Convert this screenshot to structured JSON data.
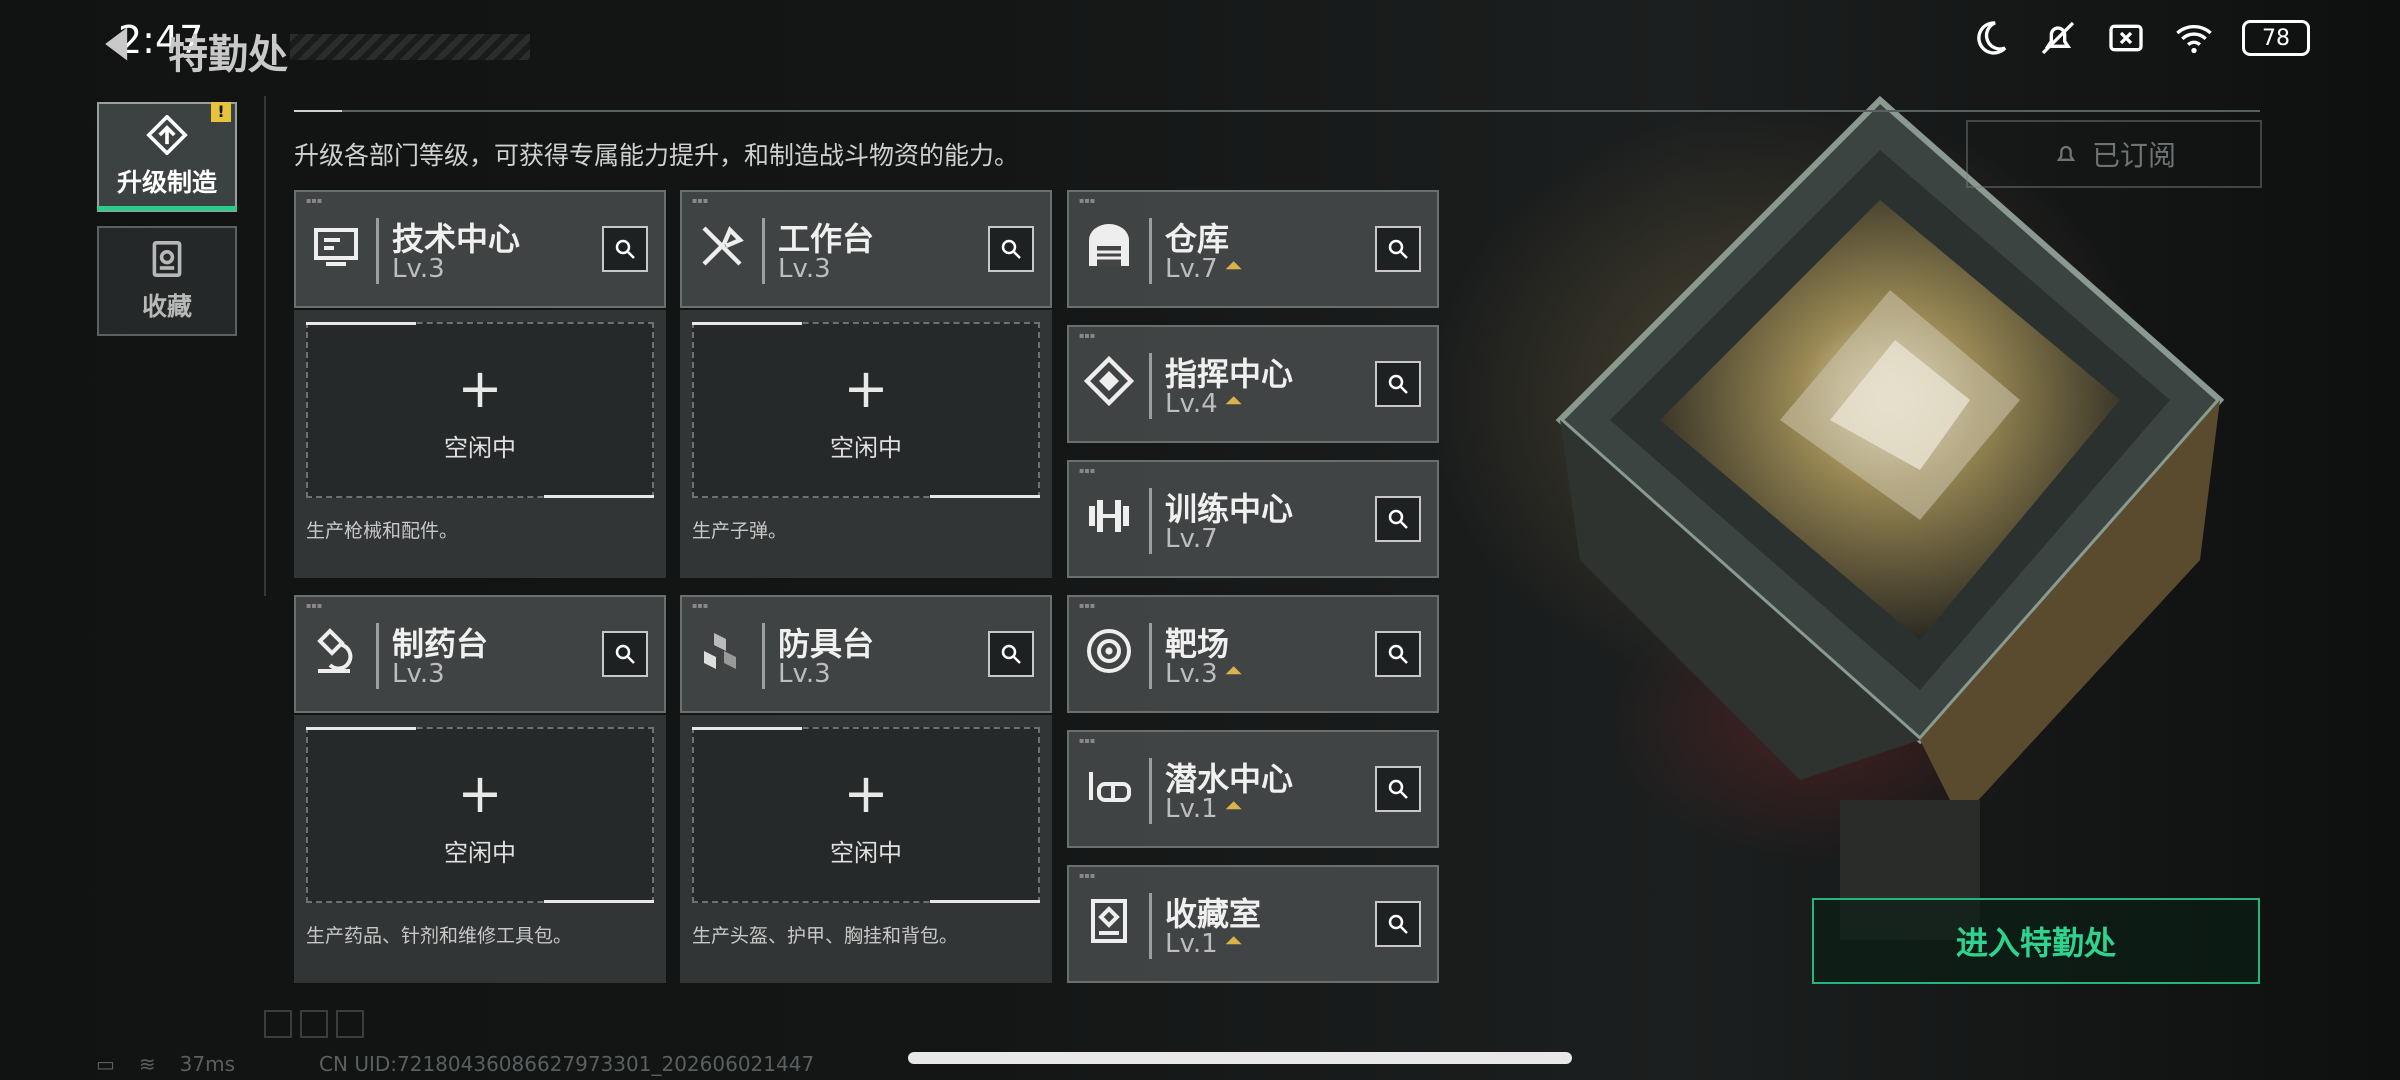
{
  "status_bar": {
    "time": "2:47",
    "battery": "78",
    "icons": [
      "moon-icon",
      "mute-icon",
      "sim-off-icon",
      "wifi-icon",
      "battery-icon"
    ]
  },
  "header": {
    "title": "特勤处",
    "subtitle": "升级各部门等级，可获得专属能力提升，和制造战斗物资的能力。"
  },
  "nav": {
    "items": [
      {
        "label": "升级制造",
        "icon": "upgrade-icon",
        "active": true,
        "badge": "!"
      },
      {
        "label": "收藏",
        "icon": "collection-icon",
        "active": false
      }
    ]
  },
  "production": [
    {
      "name": "技术中心",
      "level": "Lv.3",
      "icon": "tech-center-icon",
      "slot_status": "空闲中",
      "description": "生产枪械和配件。"
    },
    {
      "name": "工作台",
      "level": "Lv.3",
      "icon": "workbench-icon",
      "slot_status": "空闲中",
      "description": "生产子弹。"
    },
    {
      "name": "制药台",
      "level": "Lv.3",
      "icon": "pharmacy-icon",
      "slot_status": "空闲中",
      "description": "生产药品、针剂和维修工具包。"
    },
    {
      "name": "防具台",
      "level": "Lv.3",
      "icon": "armor-bench-icon",
      "slot_status": "空闲中",
      "description": "生产头盔、护甲、胸挂和背包。"
    }
  ],
  "facilities": [
    {
      "name": "仓库",
      "level": "Lv.7",
      "icon": "warehouse-icon",
      "upgradable": true
    },
    {
      "name": "指挥中心",
      "level": "Lv.4",
      "icon": "command-center-icon",
      "upgradable": true
    },
    {
      "name": "训练中心",
      "level": "Lv.7",
      "icon": "training-center-icon",
      "upgradable": false
    },
    {
      "name": "靶场",
      "level": "Lv.3",
      "icon": "shooting-range-icon",
      "upgradable": true
    },
    {
      "name": "潜水中心",
      "level": "Lv.1",
      "icon": "diving-center-icon",
      "upgradable": true
    },
    {
      "name": "收藏室",
      "level": "Lv.1",
      "icon": "collection-room-icon",
      "upgradable": true
    }
  ],
  "right": {
    "subscribed_label": "已订阅",
    "enter_label": "进入特勤处"
  },
  "footer": {
    "ping": "37ms",
    "uid": "CN UID:72180436086627973301_202606021447"
  },
  "colors": {
    "accent_green": "#2fd38e",
    "upgrade_gold": "#d9b24a",
    "badge_yellow": "#e6c33b"
  }
}
